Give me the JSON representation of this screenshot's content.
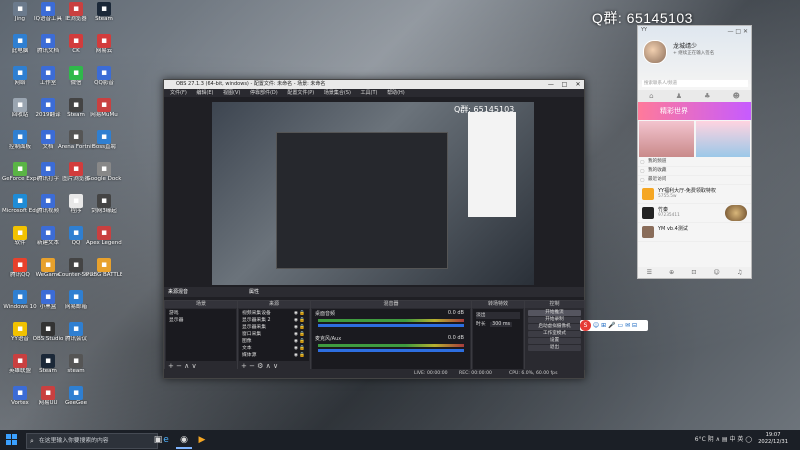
{
  "desktop": {
    "qq_group_overlay": "Q群:  65145103",
    "icons": [
      {
        "label": "Jing",
        "color": "#6b7a8c"
      },
      {
        "label": "IQ语音工具",
        "color": "#3c6cd6"
      },
      {
        "label": "IE浏览器",
        "color": "#c94040"
      },
      {
        "label": "Steam",
        "color": "#1b2838"
      },
      {
        "label": "此电脑",
        "color": "#2f7fd1"
      },
      {
        "label": "腾讯文档",
        "color": "#3c6cd6"
      },
      {
        "label": "CK",
        "color": "#d23c3c"
      },
      {
        "label": "网易云",
        "color": "#d23c3c"
      },
      {
        "label": "网络",
        "color": "#2f7fd1"
      },
      {
        "label": "工作室",
        "color": "#3c6cd6"
      },
      {
        "label": "微信",
        "color": "#2fb84a"
      },
      {
        "label": "QQ影音",
        "color": "#3c6cd6"
      },
      {
        "label": "回收站",
        "color": "#9aa5b1"
      },
      {
        "label": "2019翻译",
        "color": "#3c6cd6"
      },
      {
        "label": "Steam",
        "color": "#444"
      },
      {
        "label": "网易MuMu",
        "color": "#c94040"
      },
      {
        "label": "控制面板",
        "color": "#2f7fd1"
      },
      {
        "label": "文档",
        "color": "#3c6cd6"
      },
      {
        "label": "Arena Fortnite",
        "color": "#555"
      },
      {
        "label": "Boss直聘",
        "color": "#2f7fd1"
      },
      {
        "label": "GeForce Experience",
        "color": "#5ab445"
      },
      {
        "label": "腾讯打字",
        "color": "#3c6cd6"
      },
      {
        "label": "图片浏览器",
        "color": "#d23c3c"
      },
      {
        "label": "Google Dock",
        "color": "#888"
      },
      {
        "label": "Microsoft Edge",
        "color": "#1f8cd6"
      },
      {
        "label": "腾讯视频",
        "color": "#3c6cd6"
      },
      {
        "label": "程序",
        "color": "#e8e8e8"
      },
      {
        "label": "剑网3缘起",
        "color": "#444"
      },
      {
        "label": "软件",
        "color": "#f2c200"
      },
      {
        "label": "新建文本",
        "color": "#3c6cd6"
      },
      {
        "label": "QQ",
        "color": "#2f7fd1"
      },
      {
        "label": "Apex Legends",
        "color": "#c94040"
      },
      {
        "label": "腾讯QQ",
        "color": "#e8412c"
      },
      {
        "label": "WeGame",
        "color": "#e8a12c"
      },
      {
        "label": "Counter-Strike",
        "color": "#444"
      },
      {
        "label": "PUBG BATTLEGROUNDS",
        "color": "#e8a12c"
      },
      {
        "label": "Windows 10",
        "color": "#2f7fd1"
      },
      {
        "label": "小黑盒",
        "color": "#3c6cd6"
      },
      {
        "label": "网易邮箱",
        "color": "#2f7fd1"
      },
      {
        "label": "",
        "color": "transparent"
      },
      {
        "label": "YY语音",
        "color": "#f2c200"
      },
      {
        "label": "OBS Studio",
        "color": "#333"
      },
      {
        "label": "腾讯会议",
        "color": "#2f7fd1"
      },
      {
        "label": "",
        "color": "transparent"
      },
      {
        "label": "英雄联盟",
        "color": "#c94040"
      },
      {
        "label": "Steam",
        "color": "#1b2838"
      },
      {
        "label": "steam",
        "color": "#555"
      },
      {
        "label": "",
        "color": "transparent"
      },
      {
        "label": "Vortex",
        "color": "#3c6cd6"
      },
      {
        "label": "网易UU",
        "color": "#c94040"
      },
      {
        "label": "GeeGee",
        "color": "#2f7fd1"
      },
      {
        "label": "",
        "color": "transparent"
      }
    ]
  },
  "obs": {
    "title": "OBS 27.1.3 (64-bit, windows) - 配置文件: 未命名 - 场景: 未命名",
    "window_controls": [
      "—",
      "□",
      "✕"
    ],
    "menu": [
      "文件(F)",
      "编辑(E)",
      "视图(V)",
      "停靠部件(D)",
      "配置文件(P)",
      "场景集合(S)",
      "工具(T)",
      "帮助(H)"
    ],
    "preview_qq_text": "Q群: 65145103",
    "docks": {
      "scenes": {
        "title": "场景",
        "items": [
          "游戏",
          "显示器"
        ],
        "footer": "+ − ∧ ∨"
      },
      "sources": {
        "title": "来源",
        "items": [
          "视频采集设备",
          "显示器采集 2",
          "显示器采集",
          "窗口采集",
          "图像",
          "文本",
          "媒体源"
        ],
        "footer": "+ − ⚙ ∧ ∨"
      },
      "mixer": {
        "title": "混音器",
        "ch1": "桌面音频",
        "ch1_db": "0.0 dB",
        "ch2": "麦克风/Aux",
        "ch2_db": "0.0 dB"
      },
      "transitions": {
        "title": "转场特效",
        "type": "淡出",
        "duration_label": "时长",
        "duration": "300 ms"
      },
      "controls": {
        "title": "控制",
        "buttons": [
          "开始推流",
          "开始录制",
          "启动虚拟摄像机",
          "工作室模式",
          "设置",
          "退出"
        ]
      }
    },
    "tab_labels": {
      "left": "来源混音",
      "right": "属性"
    },
    "status": {
      "live": "LIVE: 00:00:00",
      "rec": "REC: 00:00:00",
      "cpu": "CPU: 6.0%, 60.00 fps"
    }
  },
  "floating_toolbar": {
    "label": "S",
    "icons": [
      "☺",
      "⊞",
      "🎤",
      "▭",
      "✉",
      "⊟"
    ]
  },
  "qq_panel": {
    "title": "YY",
    "controls": [
      "—",
      "□",
      "✕"
    ],
    "user_name": "龙城靖少",
    "signature": "+ 继续正在输入签名",
    "search_placeholder": "搜索联系人/频道",
    "banner_text": "精彩世界",
    "list_items": [
      "我的频道",
      "我的收藏",
      "最近访问"
    ],
    "apps": [
      {
        "name": "YY福利大厅-免费领取特权",
        "sub": "5755.5w",
        "color": "#f5a623"
      },
      {
        "name": "竹秦",
        "sub": "97235411",
        "color": "#222"
      },
      {
        "name": "YM vb.4测试",
        "sub": "",
        "color": "#8a6d5a"
      }
    ],
    "bottom_icons": [
      "☰",
      "⊕",
      "⊡",
      "☺",
      "♫"
    ]
  },
  "taskbar": {
    "search_placeholder": "在这里输入你要搜索的内容",
    "apps": [
      "▣",
      "e",
      "◉",
      "▶"
    ],
    "tray": "6°C 阴 ∧ ▤ 中 英 ◯",
    "time": "19:07",
    "date": "2022/12/31"
  }
}
